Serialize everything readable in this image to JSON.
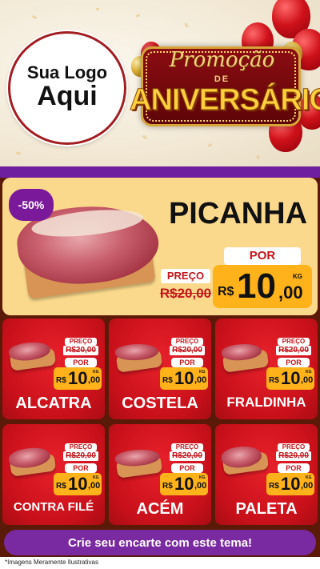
{
  "header": {
    "logo_line1": "Sua Logo",
    "logo_line2": "Aqui",
    "promo_title": "Promoção",
    "promo_de": "DE",
    "promo_subtitle": "ANIVERSÁRIO"
  },
  "hero": {
    "discount_badge": "-50%",
    "product_name": "PICANHA",
    "preco_label": "PREÇO",
    "old_price": "R$20,00",
    "por_label": "POR",
    "currency": "R$",
    "price_int": "10",
    "price_cents": ",00",
    "unit": "KG"
  },
  "products": [
    {
      "name": "ALCATRA",
      "preco_label": "PREÇO",
      "old_price": "R$20,00",
      "por_label": "POR",
      "currency": "R$",
      "price_int": "10",
      "price_cents": ",00",
      "unit": "KG"
    },
    {
      "name": "COSTELA",
      "preco_label": "PREÇO",
      "old_price": "R$20,00",
      "por_label": "POR",
      "currency": "R$",
      "price_int": "10",
      "price_cents": ",00",
      "unit": "KG"
    },
    {
      "name": "FRALDINHA",
      "preco_label": "PREÇO",
      "old_price": "R$20,00",
      "por_label": "POR",
      "currency": "R$",
      "price_int": "10",
      "price_cents": ",00",
      "unit": "KG"
    },
    {
      "name": "CONTRA FILÉ",
      "preco_label": "PREÇO",
      "old_price": "R$20,00",
      "por_label": "POR",
      "currency": "R$",
      "price_int": "10",
      "price_cents": ",00",
      "unit": "KG"
    },
    {
      "name": "ACÉM",
      "preco_label": "PREÇO",
      "old_price": "R$20,00",
      "por_label": "POR",
      "currency": "R$",
      "price_int": "10",
      "price_cents": ",00",
      "unit": "KG"
    },
    {
      "name": "PALETA",
      "preco_label": "PREÇO",
      "old_price": "R$20,00",
      "por_label": "POR",
      "currency": "R$",
      "price_int": "10",
      "price_cents": ",00",
      "unit": "KG"
    }
  ],
  "cta": {
    "label": "Crie seu encarte com este tema!"
  },
  "footer": {
    "note": "*Imagens Meramente Ilustrativas"
  },
  "colors": {
    "card_red": "#c8101a",
    "price_yellow": "#ffb21a",
    "accent_purple": "#7a2aa0",
    "hero_bg": "#fbd98c",
    "page_bg": "#5b1a07"
  }
}
